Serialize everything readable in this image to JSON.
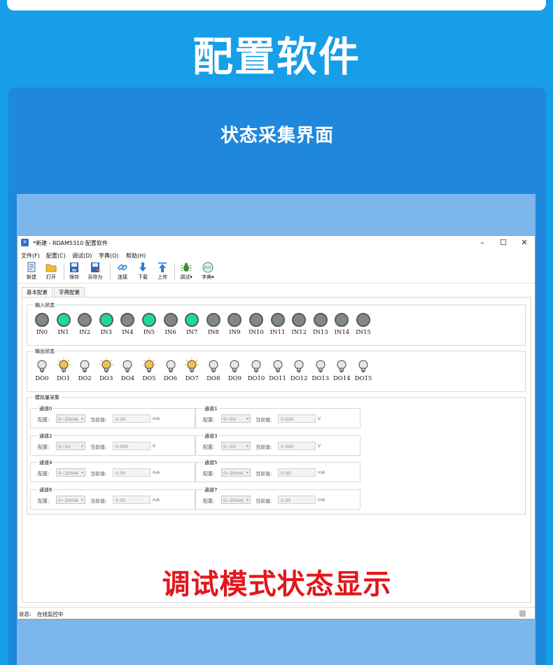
{
  "page": {
    "title": "配置软件",
    "subtitle": "状态采集界面",
    "caption": "调试模式状态显示"
  },
  "window": {
    "title": "*新建 - RDAM5310 配置软件",
    "controls": [
      "–",
      "☐",
      "✕"
    ]
  },
  "menu": [
    "文件(F)",
    "配置(C)",
    "调试(D)",
    "字典(O)",
    "帮助(H)"
  ],
  "toolbar": [
    {
      "label": "新建",
      "icon": "new-file-icon"
    },
    {
      "label": "打开",
      "icon": "folder-open-icon"
    },
    {
      "label": "保存",
      "icon": "save-icon"
    },
    {
      "label": "另存为",
      "icon": "save-as-icon"
    },
    {
      "label": "连接",
      "icon": "link-icon"
    },
    {
      "label": "下载",
      "icon": "download-arrow-icon"
    },
    {
      "label": "上传",
      "icon": "upload-arrow-icon"
    },
    {
      "label": "调试",
      "icon": "bug-icon"
    },
    {
      "label": "字典",
      "icon": "eds-icon"
    }
  ],
  "tabs": [
    "基本配置",
    "字典配置"
  ],
  "input_group": {
    "title": "输入状态",
    "channels": [
      {
        "label": "IN0",
        "active": false
      },
      {
        "label": "IN1",
        "active": true
      },
      {
        "label": "IN2",
        "active": false
      },
      {
        "label": "IN3",
        "active": true
      },
      {
        "label": "IN4",
        "active": false
      },
      {
        "label": "IN5",
        "active": true
      },
      {
        "label": "IN6",
        "active": false
      },
      {
        "label": "IN7",
        "active": true
      },
      {
        "label": "IN8",
        "active": false
      },
      {
        "label": "IN9",
        "active": false
      },
      {
        "label": "IN10",
        "active": false
      },
      {
        "label": "IN11",
        "active": false
      },
      {
        "label": "IN12",
        "active": false
      },
      {
        "label": "IN13",
        "active": false
      },
      {
        "label": "IN14",
        "active": false
      },
      {
        "label": "IN15",
        "active": false
      }
    ]
  },
  "output_group": {
    "title": "输出状态",
    "channels": [
      {
        "label": "DO0",
        "on": false
      },
      {
        "label": "DO1",
        "on": true
      },
      {
        "label": "DO2",
        "on": false
      },
      {
        "label": "DO3",
        "on": true
      },
      {
        "label": "DO4",
        "on": false
      },
      {
        "label": "DO5",
        "on": true
      },
      {
        "label": "DO6",
        "on": false
      },
      {
        "label": "DO7",
        "on": true
      },
      {
        "label": "DO8",
        "on": false
      },
      {
        "label": "DO9",
        "on": false
      },
      {
        "label": "DO10",
        "on": false
      },
      {
        "label": "DO11",
        "on": false
      },
      {
        "label": "DO12",
        "on": false
      },
      {
        "label": "DO13",
        "on": false
      },
      {
        "label": "DO14",
        "on": false
      },
      {
        "label": "DO15",
        "on": false
      }
    ]
  },
  "analog_group": {
    "title": "模拟量采集",
    "config_label": "配置:",
    "current_label": "当前值:",
    "channels": [
      {
        "name": "通道0",
        "range": "0~20mA",
        "value": "0.00",
        "unit": "mA"
      },
      {
        "name": "通道1",
        "range": "0~5V",
        "value": "0.000",
        "unit": "V"
      },
      {
        "name": "通道2",
        "range": "0~5V",
        "value": "0.000",
        "unit": "V"
      },
      {
        "name": "通道3",
        "range": "0~5V",
        "value": "0.000",
        "unit": "V"
      },
      {
        "name": "通道4",
        "range": "0~20mA",
        "value": "0.00",
        "unit": "mA"
      },
      {
        "name": "通道5",
        "range": "0~20mA",
        "value": "0.00",
        "unit": "mA"
      },
      {
        "name": "通道6",
        "range": "0~20mA",
        "value": "0.00",
        "unit": "mA"
      },
      {
        "name": "通道7",
        "range": "0~20mA",
        "value": "0.00",
        "unit": "mA"
      }
    ]
  },
  "statusbar": {
    "label": "状态:",
    "text": "在线监控中"
  },
  "colors": {
    "background": "#169ee8",
    "panel": "#1f87dc",
    "led_on": "#1ed89c",
    "led_off": "#7e8a86",
    "bulb_on": "#f2c24e",
    "caption": "#e3161b"
  }
}
